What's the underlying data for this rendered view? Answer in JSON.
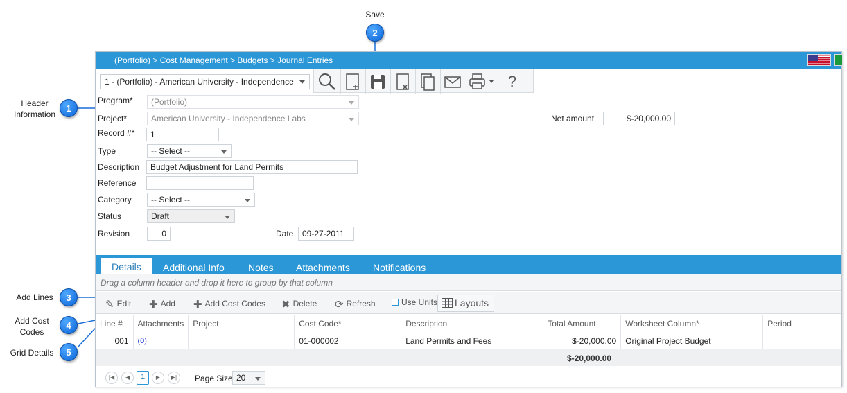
{
  "callouts": [
    {
      "num": "1",
      "label": "Header Information"
    },
    {
      "num": "2",
      "label": "Save"
    },
    {
      "num": "3",
      "label": "Add Lines"
    },
    {
      "num": "4",
      "label": "Add Cost Codes"
    },
    {
      "num": "5",
      "label": "Grid Details"
    }
  ],
  "header": {
    "breadcrumb_link": "(Portfolio)",
    "breadcrumb_rest": " > Cost Management > Budgets > Journal Entries",
    "flag_us": "us-flag-icon",
    "flag_br": "brazil-flag-icon"
  },
  "toolbar": {
    "record_select": "1 - (Portfolio) - American University - Independence",
    "icons": [
      "search-icon",
      "new-document-icon",
      "save-icon",
      "delete-document-icon",
      "copy-icon",
      "email-icon",
      "print-icon",
      "help-icon"
    ]
  },
  "form": {
    "program_label": "Program*",
    "program_value": "(Portfolio)",
    "project_label": "Project*",
    "project_value": "American University - Independence Labs",
    "record_label": "Record #*",
    "record_value": "1",
    "type_label": "Type",
    "type_value": "-- Select --",
    "description_label": "Description",
    "description_value": "Budget Adjustment for Land Permits",
    "reference_label": "Reference",
    "reference_value": "",
    "category_label": "Category",
    "category_value": "-- Select --",
    "status_label": "Status",
    "status_value": "Draft",
    "revision_label": "Revision",
    "revision_value": "0",
    "date_label": "Date",
    "date_value": "09-27-2011",
    "net_amount_label": "Net amount",
    "net_amount_value": "$-20,000.00"
  },
  "tabs": [
    {
      "label": "Details"
    },
    {
      "label": "Additional Info"
    },
    {
      "label": "Notes"
    },
    {
      "label": "Attachments"
    },
    {
      "label": "Notifications"
    }
  ],
  "grid": {
    "group_hint": "Drag a column header and drop it here to group by that column",
    "buttons": {
      "edit": "Edit",
      "add": "Add",
      "add_cost_codes": "Add Cost Codes",
      "delete": "Delete",
      "refresh": "Refresh",
      "use_units": "Use Units",
      "layouts": "Layouts"
    },
    "columns": [
      "Line #",
      "Attachments",
      "Project",
      "Cost Code*",
      "Description",
      "Total Amount",
      "Worksheet Column*",
      "Period"
    ],
    "rows": [
      {
        "line": "001",
        "attachments": "(0)",
        "project": "",
        "cost_code": "01-000002",
        "description": "Land Permits and Fees",
        "total": "$-20,000.00",
        "worksheet": "Original Project Budget",
        "period": ""
      }
    ],
    "total": "$-20,000.00",
    "pager": {
      "current_page": "1",
      "page_size_label": "Page Size",
      "page_size": "20"
    }
  },
  "colors": {
    "accent": "#2b97d6",
    "callout": "#1a6fd8"
  }
}
